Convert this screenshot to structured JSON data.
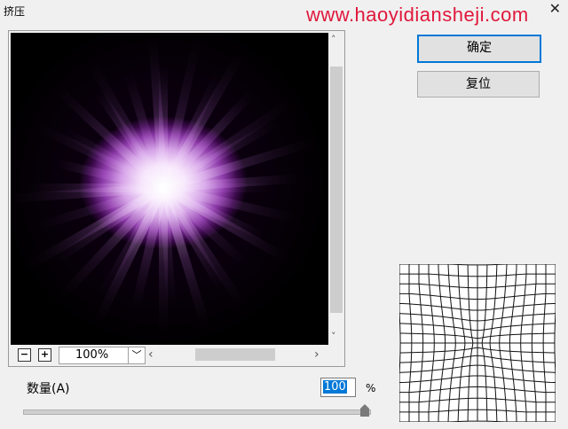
{
  "window": {
    "title": "挤压",
    "close_glyph": "✕"
  },
  "watermark": "www.haoyidiansheji.com",
  "buttons": {
    "ok": "确定",
    "reset": "复位"
  },
  "zoom": {
    "minus": "−",
    "plus": "+",
    "value": "100%",
    "dropdown_glyph": "﹀"
  },
  "scroll": {
    "up": "˄",
    "down": "˅",
    "left": "‹",
    "right": "›"
  },
  "amount": {
    "label": "数量(A)",
    "value": "100",
    "unit": "%",
    "slider_fraction": 1.0
  },
  "colors": {
    "accent": "#0078d7",
    "watermark": "#e0173b"
  },
  "icons": {
    "close": "close-icon",
    "zoom_out": "minus-icon",
    "zoom_in": "plus-icon"
  }
}
